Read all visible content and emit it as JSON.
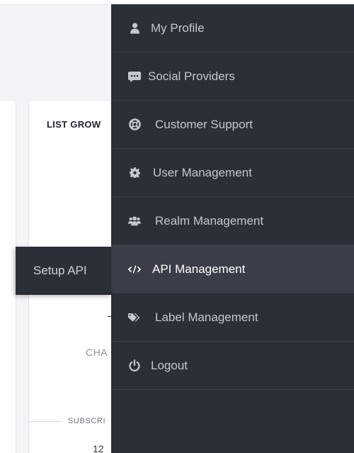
{
  "background": {
    "card_title": "LIST GROW",
    "chart_label": "CHA",
    "subscribers_label": "SUBSCRI",
    "subscribers_value": "12"
  },
  "menu": {
    "items": [
      {
        "label": "My Profile",
        "icon": "user-icon"
      },
      {
        "label": "Social Providers",
        "icon": "chat-icon"
      },
      {
        "label": "Customer Support",
        "icon": "lifebuoy-icon"
      },
      {
        "label": "User Management",
        "icon": "gear-icon"
      },
      {
        "label": "Realm Management",
        "icon": "users-icon"
      },
      {
        "label": "API Management",
        "icon": "code-icon",
        "active": true
      },
      {
        "label": "Label Management",
        "icon": "tags-icon"
      },
      {
        "label": "Logout",
        "icon": "power-icon"
      }
    ]
  },
  "flyout": {
    "label": "Setup API"
  },
  "colors": {
    "menu_bg": "#2b2f37",
    "menu_active_bg": "#3a3e48",
    "menu_text": "#c5c8ce",
    "background": "#f3f4f6"
  }
}
